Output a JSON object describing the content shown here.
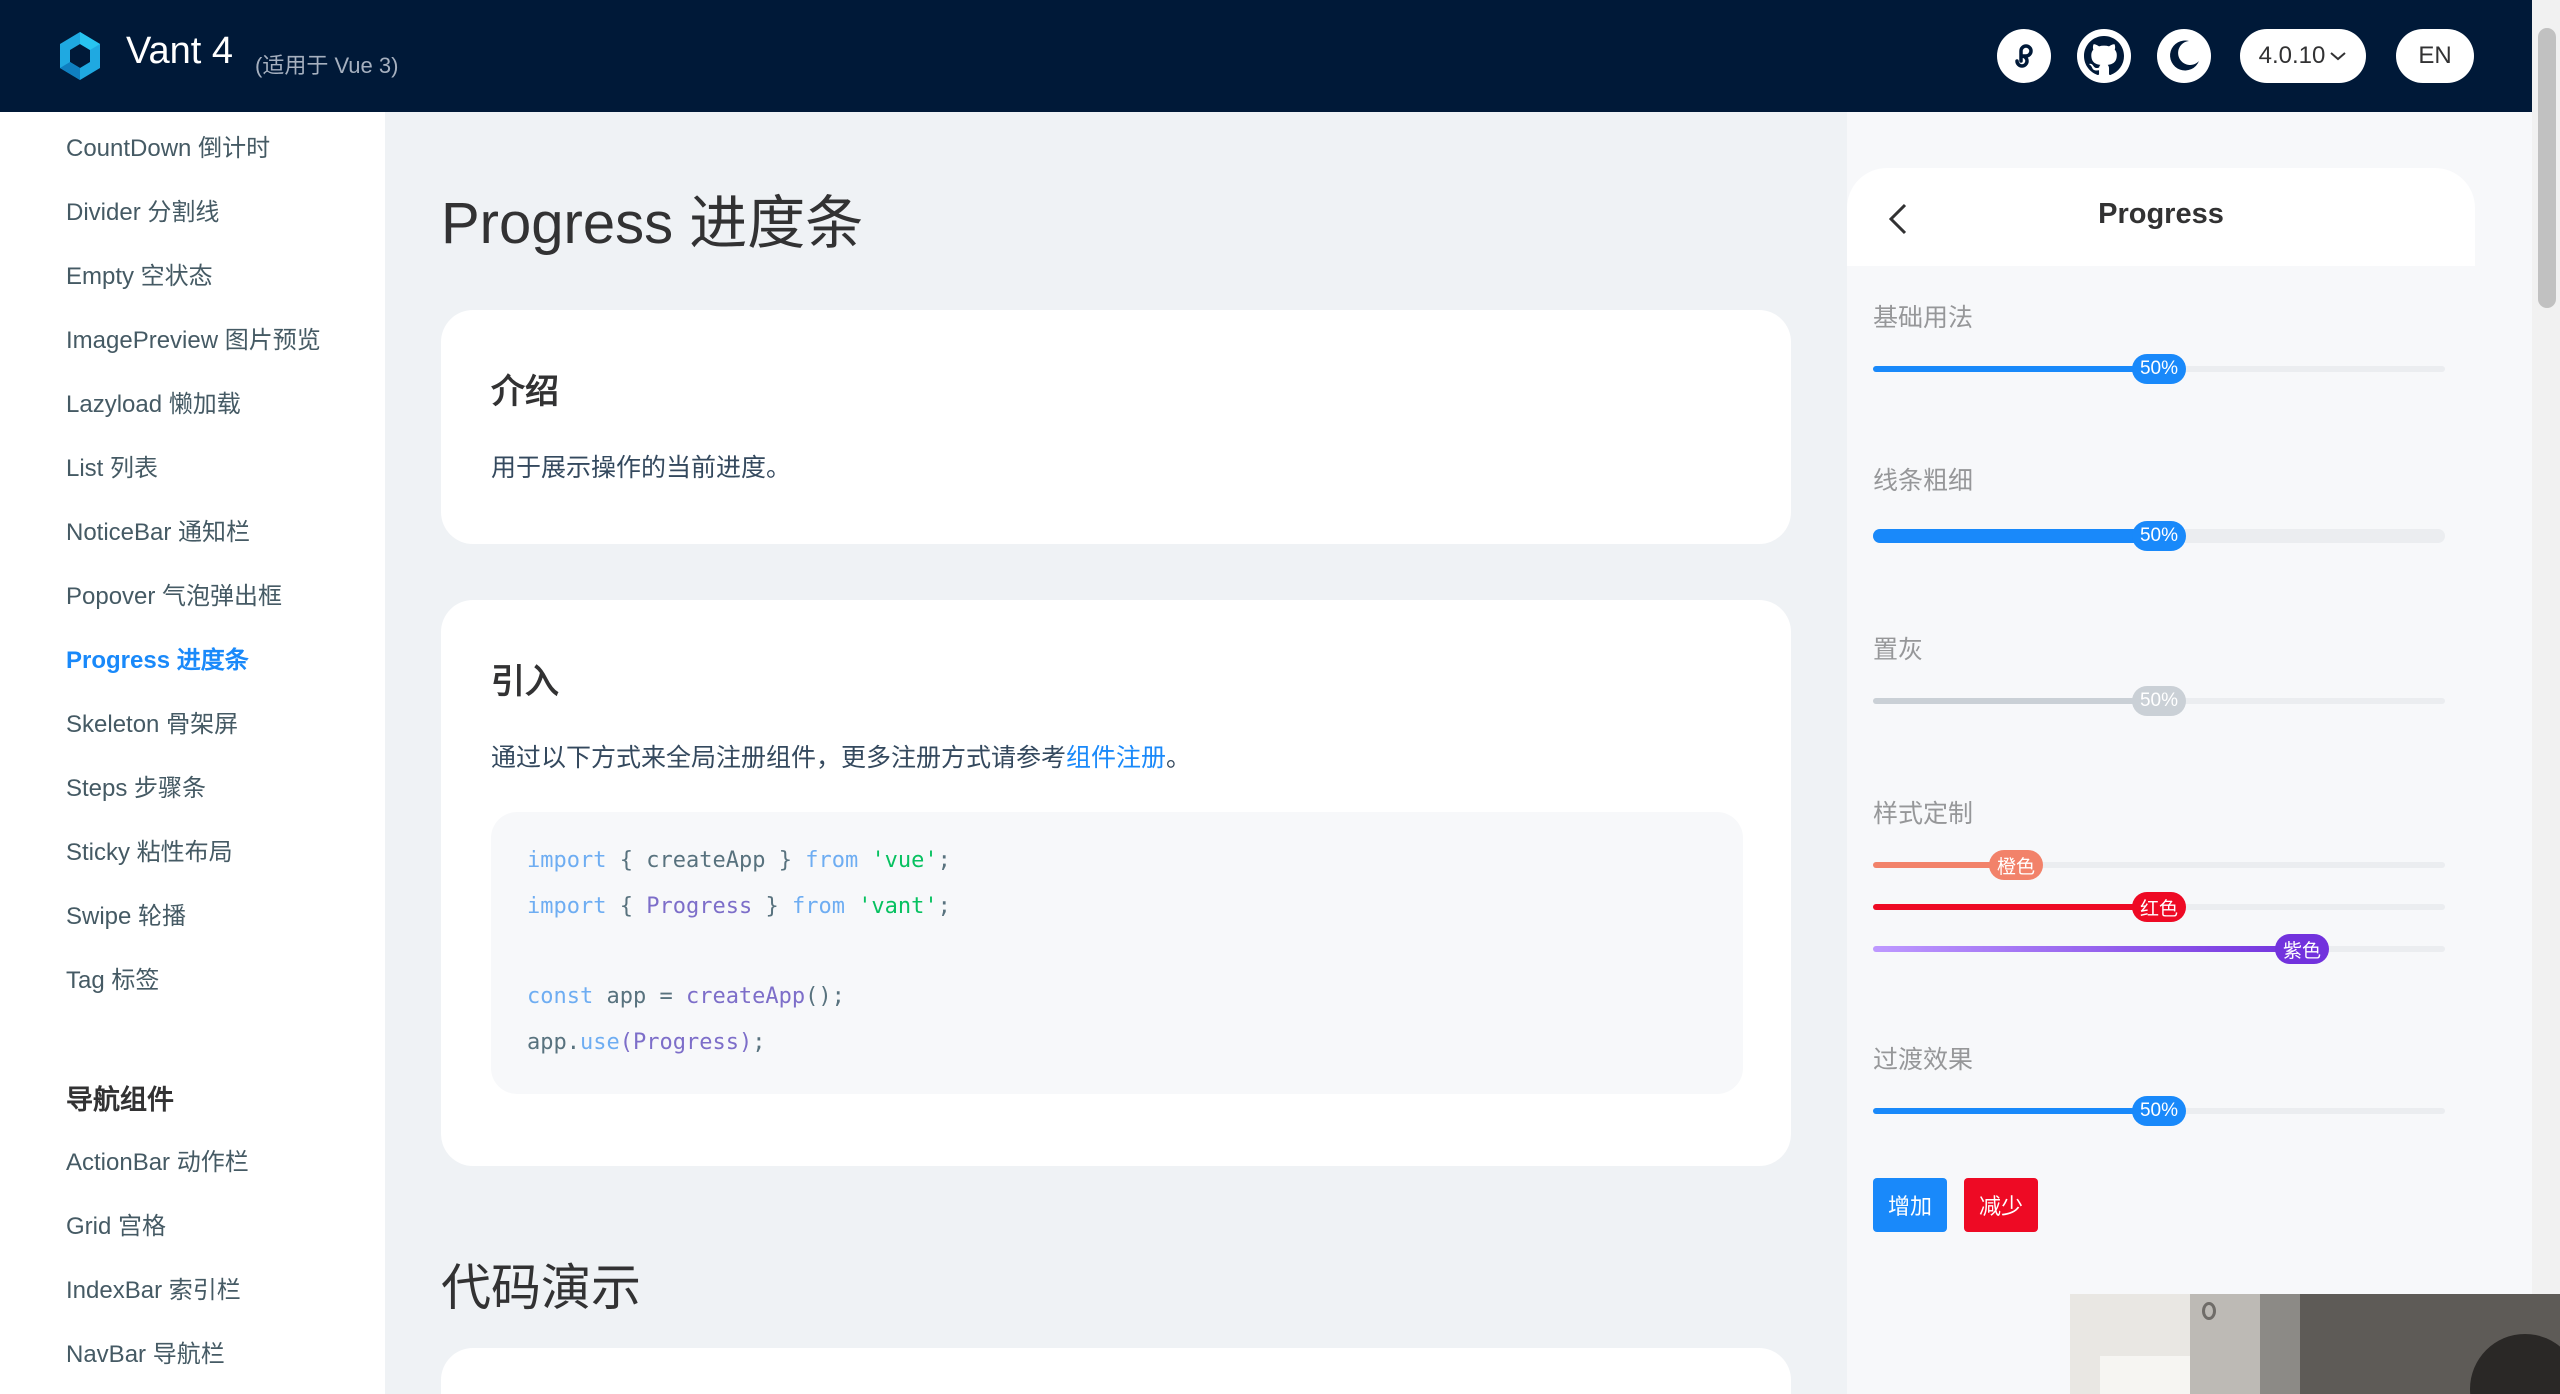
{
  "header": {
    "brand": "Vant 4",
    "subtitle": "(适用于 Vue 3)",
    "version": "4.0.10",
    "lang": "EN",
    "icons": [
      "miniprogram-icon",
      "github-icon",
      "dark-mode-icon"
    ],
    "bg_color": "#001938"
  },
  "sidebar": {
    "items": [
      "CountDown 倒计时",
      "Divider 分割线",
      "Empty 空状态",
      "ImagePreview 图片预览",
      "Lazyload 懒加载",
      "List 列表",
      "NoticeBar 通知栏",
      "Popover 气泡弹出框",
      "Progress 进度条",
      "Skeleton 骨架屏",
      "Steps 步骤条",
      "Sticky 粘性布局",
      "Swipe 轮播",
      "Tag 标签"
    ],
    "active_index": 8,
    "group_title": "导航组件",
    "group_items": [
      "ActionBar 动作栏",
      "Grid 宫格",
      "IndexBar 索引栏",
      "NavBar 导航栏"
    ]
  },
  "main": {
    "title": "Progress 进度条",
    "intro": {
      "heading": "介绍",
      "text": "用于展示操作的当前进度。"
    },
    "import": {
      "heading": "引入",
      "text_before": "通过以下方式来全局注册组件，更多注册方式请参考",
      "link": "组件注册",
      "text_after": "。",
      "code": {
        "line1": {
          "kw": "import",
          "open": " { ",
          "name": "createApp",
          "close": " } ",
          "from": "from",
          "str": "'vue'",
          "end": ";"
        },
        "line2": {
          "kw": "import",
          "open": " { ",
          "name": "Progress",
          "close": " } ",
          "from": "from",
          "str": "'vant'",
          "end": ";"
        },
        "line3": {
          "kw": "const",
          "var": " app = ",
          "fn": "createApp",
          "end": "();"
        },
        "line4": {
          "obj": "app.",
          "fn": "use",
          "arg": "(Progress)",
          "end": ";"
        }
      }
    },
    "demo_heading": "代码演示"
  },
  "simulator": {
    "title": "Progress",
    "demos": [
      {
        "title": "基础用法",
        "pivot": "50%",
        "percent": 50,
        "color": "#1989fa"
      },
      {
        "title": "线条粗细",
        "pivot": "50%",
        "percent": 50,
        "color": "#1989fa"
      },
      {
        "title": "置灰",
        "pivot": "50%",
        "percent": 50,
        "color": "#cad0d6"
      },
      {
        "title": "样式定制",
        "bars": [
          {
            "pivot": "橙色",
            "percent": 25,
            "color": "#f2826a"
          },
          {
            "pivot": "红色",
            "percent": 50,
            "color": "#ee0a24"
          },
          {
            "pivot": "紫色",
            "percent": 75,
            "color": "#7232dd"
          }
        ]
      },
      {
        "title": "过渡效果",
        "pivot": "50%",
        "percent": 50,
        "color": "#1989fa"
      }
    ],
    "buttons": {
      "add": "增加",
      "reduce": "减少"
    }
  }
}
